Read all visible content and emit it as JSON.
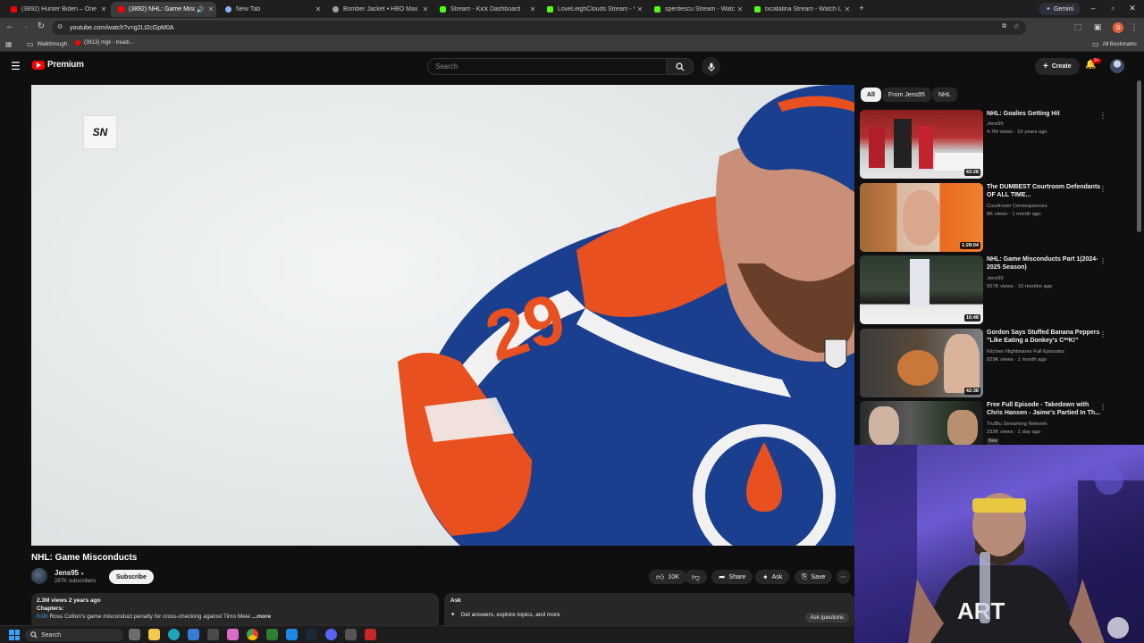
{
  "browser": {
    "tabs": [
      {
        "title": "(3892) Hunter Biden – One of t",
        "color": "#ff0000"
      },
      {
        "title": "(3892) NHL: Game Misconduct",
        "color": "#ff0000"
      },
      {
        "title": "New Tab",
        "color": "#8ab4f8"
      },
      {
        "title": "Bomber Jacket • HBO Max",
        "color": "#9aa0a6"
      },
      {
        "title": "Stream - Kick Dashboard",
        "color": "#53fc18"
      },
      {
        "title": "LoveLeighClouds Stream - Watc",
        "color": "#53fc18"
      },
      {
        "title": "spentescu Stream - Watch Live",
        "color": "#53fc18"
      },
      {
        "title": "txcatalina Stream - Watch Live",
        "color": "#53fc18"
      }
    ],
    "gemini_label": "Gemini",
    "url": "youtube.com/watch?v=g2Lt2cGpM0A",
    "bookmarks": [
      {
        "label": "Walkthrough"
      },
      {
        "label": "(3813) mgk - treadi..."
      }
    ],
    "all_bookmarks": "All Bookmarks",
    "profile_initial": "S"
  },
  "youtube": {
    "brand": "Premium",
    "search_placeholder": "Search",
    "create_label": "Create",
    "notif_count": "9+",
    "video": {
      "overlay_logo": "SN",
      "title": "NHL: Game Misconducts",
      "channel": "Jens95",
      "subscribers": "287K subscribers",
      "subscribe_label": "Subscribe",
      "likes": "10K",
      "share_label": "Share",
      "ask_label": "Ask",
      "save_label": "Save",
      "stats": "2.3M views  2 years ago",
      "chapters_label": "Chapters:",
      "chapter_time": "0:00",
      "chapter_text": "Ross Colton's game misconduct penalty for cross-checking against Timo Meie",
      "more_label": "...more"
    },
    "ask_panel": {
      "title": "Ask",
      "prompt": "Get answers, explore topics, and more",
      "button": "Ask questions"
    },
    "chips": [
      "All",
      "From Jens95",
      "NHL"
    ],
    "recommendations": [
      {
        "title": "NHL: Goalies Getting Hit",
        "channel": "Jens95",
        "meta": "4.7M views · 10 years ago",
        "duration": "43:28",
        "new": ""
      },
      {
        "title": "The DUMBEST Courtroom Defendants OF ALL TIME...",
        "channel": "Courtroom Consequences",
        "meta": "8K views · 1 month ago",
        "duration": "1:28:04",
        "new": ""
      },
      {
        "title": "NHL: Game Misconducts Part 1(2024-2025 Season)",
        "channel": "Jens95",
        "meta": "557K views · 10 months ago",
        "duration": "16:48",
        "new": ""
      },
      {
        "title": "Gordon Says Stuffed Banana Peppers \"Like Eating a Donkey's C**K!\"",
        "channel": "Kitchen Nightmares Full Episodes",
        "meta": "829K views · 1 month ago",
        "duration": "42:38",
        "new": ""
      },
      {
        "title": "Free Full Episode - Takedown with Chris Hansen - Jaime's Partied In Th...",
        "channel": "TruBlu Streaming Network",
        "meta": "232K views · 1 day ago",
        "duration": "",
        "new": "New"
      }
    ]
  },
  "taskbar": {
    "search_label": "Search"
  },
  "colors": {
    "yt_red": "#ff0000",
    "bg": "#0f0f0f",
    "oilers_blue": "#1b3f8f",
    "oilers_orange": "#e8501f",
    "webcam_purple": "#5c4bc4"
  }
}
